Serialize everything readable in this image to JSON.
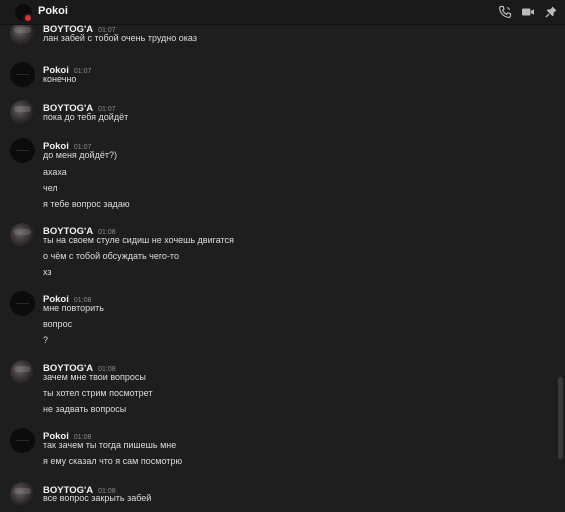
{
  "header": {
    "title": "Pokoi",
    "icons": [
      "call-icon",
      "video-icon",
      "pin-icon"
    ]
  },
  "messages": [
    {
      "author": "BOYTOG'A",
      "time": "01:07",
      "avatar": "boy",
      "lines": [
        "лан забей с тобой очень трудно оказ"
      ]
    },
    {
      "author": "Pokoi",
      "time": "01:07",
      "avatar": "pokoi",
      "lines": [
        "конечно"
      ]
    },
    {
      "author": "BOYTOG'A",
      "time": "01:07",
      "avatar": "boy",
      "lines": [
        "пока до тебя дойдёт"
      ]
    },
    {
      "author": "Pokoi",
      "time": "01:07",
      "avatar": "pokoi",
      "lines": [
        "до меня дойдёт?)",
        "ахаха",
        "чел",
        "я тебе вопрос задаю"
      ]
    },
    {
      "author": "BOYTOG'A",
      "time": "01:08",
      "avatar": "boy",
      "lines": [
        "ты на своем стуле сидиш не хочешь двигатся",
        "о чём с тобой обсуждать чего-то",
        "хз"
      ]
    },
    {
      "author": "Pokoi",
      "time": "01:08",
      "avatar": "pokoi",
      "lines": [
        "мне повторить",
        "вопрос",
        "?"
      ]
    },
    {
      "author": "BOYTOG'A",
      "time": "01:08",
      "avatar": "boy",
      "lines": [
        "зачем мне твои вопросы",
        "ты хотел стрим посмотрет",
        "не задвать вопросы"
      ]
    },
    {
      "author": "Pokoi",
      "time": "01:08",
      "avatar": "pokoi",
      "lines": [
        "так зачем ты тогда пишешь мне",
        "я ему сказал что я сам посмотрю"
      ]
    },
    {
      "author": "BOYTOG'A",
      "time": "01:08",
      "avatar": "boy",
      "lines": [
        "все вопрос закрыть забей"
      ]
    }
  ]
}
